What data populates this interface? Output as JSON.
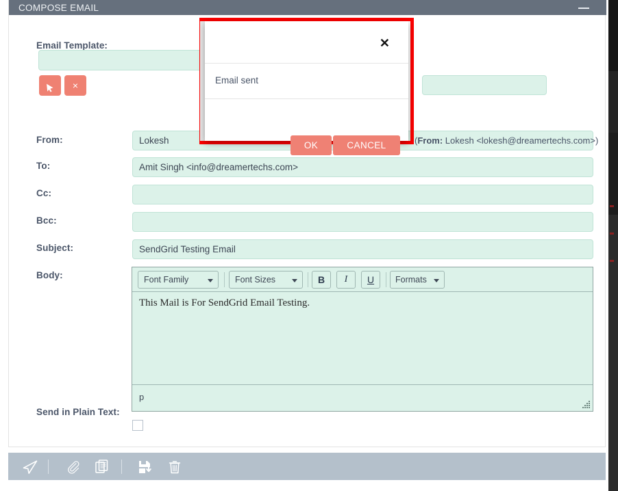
{
  "window": {
    "title": "COMPOSE EMAIL",
    "minimize_icon": "minimize-icon"
  },
  "form": {
    "labels": {
      "email_template": "Email Template:",
      "from": "From:",
      "to": "To:",
      "cc": "Cc:",
      "bcc": "Bcc:",
      "subject": "Subject:",
      "body": "Body:",
      "plain_text": "Send in Plain Text:"
    },
    "values": {
      "email_template": "",
      "email_template_secondary": "",
      "from": "Lokesh",
      "to": "Amit Singh <info@dreamertechs.com>",
      "cc": "",
      "bcc": "",
      "subject": "SendGrid Testing Email",
      "body_html": "This Mail is For SendGrid Email Testing."
    },
    "from_note_prefix": "(",
    "from_note_label": "From:",
    "from_note_value": " Lokesh <lokesh@dreamertechs.com>)",
    "template_actions": [
      {
        "name": "select-template-button",
        "icon": "cursor-arrow-icon",
        "label": ""
      },
      {
        "name": "clear-template-button",
        "icon": "close-x-icon",
        "label": "×"
      }
    ],
    "plain_text_checked": false
  },
  "editor": {
    "toolbar": {
      "font_family": "Font Family",
      "font_sizes": "Font Sizes",
      "bold": "B",
      "italic": "I",
      "underline": "U",
      "formats": "Formats"
    },
    "statusbar_path": "p",
    "resize_grip_icon": "resize-grip-icon"
  },
  "bottom_toolbar": {
    "icons": [
      {
        "name": "send-icon",
        "title": "Send"
      },
      {
        "name": "attachment-icon",
        "title": "Attach"
      },
      {
        "name": "copy-icon",
        "title": "Copy"
      },
      {
        "name": "save-icon",
        "title": "Save"
      },
      {
        "name": "delete-icon",
        "title": "Delete"
      }
    ]
  },
  "modal": {
    "message": "Email sent",
    "close_label": "✕",
    "ok_label": "OK",
    "cancel_label": "CANCEL"
  },
  "colors": {
    "titlebar": "#66707d",
    "field_bg": "#dcf2e9",
    "field_border": "#bfe3d6",
    "accent_red": "#ef8174",
    "highlight_red": "#fe0000",
    "bottom_toolbar": "#b4c0cb",
    "label_text": "#4a5568"
  }
}
